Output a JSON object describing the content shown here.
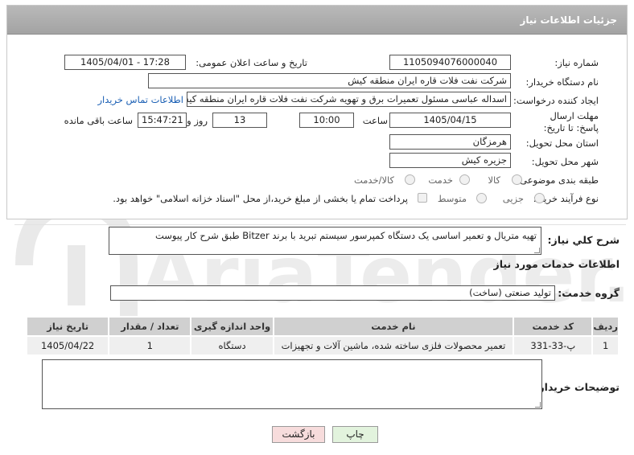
{
  "header": {
    "title": "جزئیات اطلاعات نیاز"
  },
  "fields": {
    "need_number_label": "شماره نیاز:",
    "need_number": "1105094076000040",
    "announce_label": "تاریخ و ساعت اعلان عمومی:",
    "announce_value": "1405/04/01 - 17:28",
    "buyer_label": "نام دستگاه خریدار:",
    "buyer_value": "شرکت نفت فلات قاره ایران منطقه کیش",
    "creator_label": "ایجاد کننده درخواست:",
    "creator_value": "اسداله  عباسی  مسئول تعمیرات برق و تهویه  شرکت نفت فلات قاره ایران منطقه کیش",
    "contact_link": "اطلاعات تماس خریدار",
    "deadline_label": "مهلت ارسال پاسخ: تا تاریخ:",
    "deadline_date": "1405/04/15",
    "time_label": "ساعت",
    "deadline_time": "10:00",
    "days_value": "13",
    "days_label": "روز و",
    "remaining_time": "15:47:21",
    "remaining_label": "ساعت باقی مانده",
    "province_label": "استان محل تحویل:",
    "province_value": "هرمزگان",
    "city_label": "شهر محل تحویل:",
    "city_value": "جزیره کیش",
    "category_label": "طبقه بندی موضوعی:",
    "category_options": [
      "کالا",
      "خدمت",
      "کالا/خدمت"
    ],
    "purchase_type_label": "نوع فرآیند خرید :",
    "purchase_type_options": [
      "جزیی",
      "متوسط"
    ],
    "payment_note": "پرداخت تمام یا بخشی از مبلغ خرید،از محل \"اسناد خزانه اسلامی\" خواهد بود."
  },
  "summary": {
    "label": "شرح کلي نياز:",
    "value": "تهیه متریال و تعمیر اساسی یک دستگاه کمپرسور سیستم تبرید با برند Bitzer طبق شرح کار پیوست"
  },
  "services": {
    "section_title": "اطلاعات خدمات مورد نیاز",
    "group_label": "گروه خدمت:",
    "group_value": "تولید صنعتی (ساخت)",
    "columns": [
      "ردیف",
      "کد خدمت",
      "نام خدمت",
      "واحد اندازه گیری",
      "تعداد / مقدار",
      "تاریخ نیاز"
    ],
    "rows": [
      [
        "1",
        "پ-33-331",
        "تعمیر محصولات فلزی ساخته شده، ماشین آلات و تجهیزات",
        "دستگاه",
        "1",
        "1405/04/22"
      ]
    ]
  },
  "buyer_notes": {
    "label": "توضیحات خریدار:",
    "value": ""
  },
  "buttons": {
    "print": "چاپ",
    "back": "بازگشت"
  },
  "watermark": {
    "text": "AriaTender.net"
  },
  "colors": {
    "header_bg": "#a9a9a9",
    "link": "#1a5fb4",
    "watermark": "#e8e8e8",
    "back_button_bg": "#f7dcdc",
    "print_button_bg": "#e2f3dd"
  }
}
